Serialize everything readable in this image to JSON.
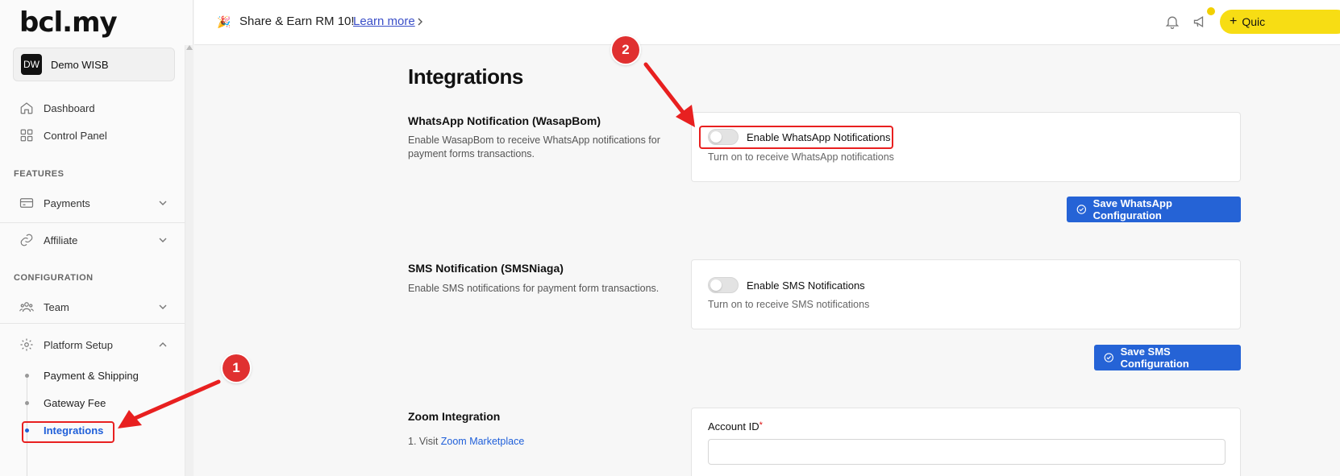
{
  "sidebar": {
    "logo": "bcl.my",
    "org": {
      "initials": "DW",
      "name": "Demo WISB"
    },
    "main_items": [
      {
        "label": "Dashboard",
        "icon": "home-icon"
      },
      {
        "label": "Control Panel",
        "icon": "grid-icon"
      }
    ],
    "features_label": "FEATURES",
    "feature_items": [
      {
        "label": "Payments",
        "icon": "credit-card-icon"
      },
      {
        "label": "Affiliate",
        "icon": "link-icon"
      }
    ],
    "configuration_label": "CONFIGURATION",
    "config_items": [
      {
        "label": "Team",
        "icon": "team-icon"
      },
      {
        "label": "Platform Setup",
        "icon": "gear-icon"
      }
    ],
    "platform_subitems": [
      {
        "label": "Payment & Shipping"
      },
      {
        "label": "Gateway Fee"
      },
      {
        "label": "Integrations",
        "active": true
      }
    ]
  },
  "topbar": {
    "promo_icon": "🎉",
    "promo_text": "Share & Earn RM 10!",
    "promo_link": "Learn more",
    "quick_label": "Quic",
    "notif_dot_color": "#f2d000"
  },
  "content": {
    "page_title": "Integrations",
    "whatsapp": {
      "title": "WhatsApp Notification (WasapBom)",
      "description": "Enable WasapBom to receive WhatsApp notifications for payment forms transactions.",
      "toggle_label": "Enable WhatsApp Notifications",
      "toggle_help": "Turn on to receive WhatsApp notifications",
      "enabled": false,
      "save_label": "Save WhatsApp Configuration"
    },
    "sms": {
      "title": "SMS Notification (SMSNiaga)",
      "description": "Enable SMS notifications for payment form transactions.",
      "toggle_label": "Enable SMS Notifications",
      "toggle_help": "Turn on to receive SMS notifications",
      "enabled": false,
      "save_label": "Save SMS Configuration"
    },
    "zoom": {
      "title": "Zoom Integration",
      "step_prefix": "1. Visit ",
      "step_link": "Zoom Marketplace",
      "account_id_label": "Account ID",
      "required_mark": "*"
    }
  },
  "annotations": {
    "badge1": "1",
    "badge2": "2",
    "color": "#e82020"
  },
  "colors": {
    "accent": "#2563d6",
    "brand_yellow": "#f7dd14",
    "active_nav": "#1f5fd9"
  }
}
